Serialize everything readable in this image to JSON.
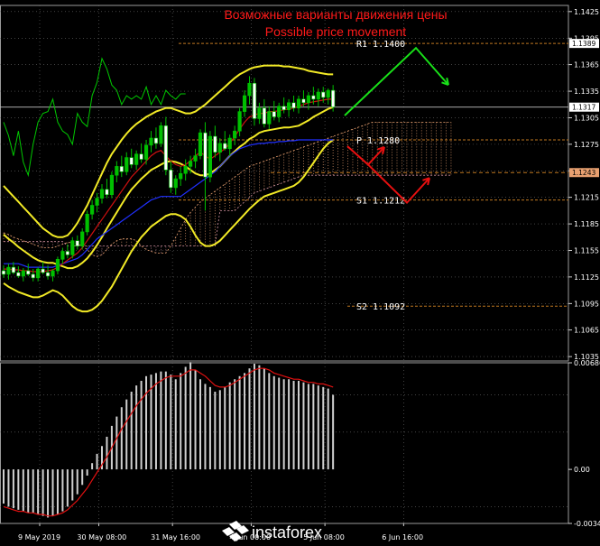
{
  "title_ru": "Возможные варианты движения цены",
  "title_en": "Possible price movement",
  "watermark": "instaforex",
  "colors": {
    "background": "#000000",
    "grid": "#6b6b6b",
    "candle_up": "#00c000",
    "candle_body_down": "#ffffff",
    "bollinger": "#f2ea26",
    "tenkan": "#d01010",
    "kijun": "#2030ff",
    "chikou": "#00c800",
    "cloud_orange": "#e8a070",
    "cloud_pink": "#d090a0",
    "up_arrow": "#19e019",
    "down_arrow": "#e81010",
    "macd_hist": "#d0d0d0",
    "macd_signal": "#e01010",
    "level_line": "#c07820",
    "title": "#ff1a1a"
  },
  "chart_data": [
    {
      "type": "candlestick",
      "title": "Возможные варианты движения цены / Possible price movement",
      "xlabel": "",
      "ylabel": "",
      "ylim": [
        1.103,
        1.1432
      ],
      "y_ticks": [
        "1.1425",
        "1.1395",
        "1.1365",
        "1.1335",
        "1.1305",
        "1.1275",
        "1.1245",
        "1.1215",
        "1.1185",
        "1.1155",
        "1.1125",
        "1.1095",
        "1.1065",
        "1.1035"
      ],
      "x_ticks": [
        "9 May 2019",
        "30 May 08:00",
        "31 May 16:00",
        "4 Jun 00:00",
        "5 Jun 08:00",
        "6 Jun 16:00"
      ],
      "x_tick_bar": [
        0,
        12,
        27,
        43,
        58,
        74
      ],
      "price_tags": [
        {
          "label": "1.1389",
          "value": 1.1389,
          "style": "white"
        },
        {
          "label": "1.1317",
          "value": 1.1317,
          "style": "white"
        },
        {
          "label": "1.1243",
          "value": 1.1243,
          "style": "orange"
        }
      ],
      "levels": [
        {
          "name": "R1",
          "label": "R1 1.1400",
          "value": 1.1389
        },
        {
          "name": "P",
          "label": "P 1.1280",
          "value": 1.128
        },
        {
          "name": "S1",
          "label": "S1 1.1212",
          "value": 1.1212
        },
        {
          "name": "S2",
          "label": "S2 1.1092",
          "value": 1.1092
        }
      ],
      "close_line": 1.1317,
      "candles": [
        [
          1.1132,
          1.1138,
          1.1124,
          1.1128
        ],
        [
          1.1128,
          1.114,
          1.1122,
          1.1136
        ],
        [
          1.1136,
          1.1142,
          1.1128,
          1.113
        ],
        [
          1.113,
          1.1137,
          1.1124,
          1.1126
        ],
        [
          1.1126,
          1.1135,
          1.112,
          1.1132
        ],
        [
          1.1132,
          1.114,
          1.1126,
          1.1128
        ],
        [
          1.1128,
          1.1134,
          1.112,
          1.1124
        ],
        [
          1.1124,
          1.1136,
          1.112,
          1.1134
        ],
        [
          1.1134,
          1.1142,
          1.1128,
          1.113
        ],
        [
          1.113,
          1.1138,
          1.1122,
          1.1126
        ],
        [
          1.1126,
          1.1134,
          1.112,
          1.1132
        ],
        [
          1.1132,
          1.1148,
          1.1128,
          1.1145
        ],
        [
          1.1145,
          1.1158,
          1.114,
          1.1154
        ],
        [
          1.1154,
          1.1162,
          1.1146,
          1.115
        ],
        [
          1.115,
          1.117,
          1.1146,
          1.1166
        ],
        [
          1.1166,
          1.1172,
          1.1156,
          1.116
        ],
        [
          1.116,
          1.118,
          1.1156,
          1.1176
        ],
        [
          1.1176,
          1.12,
          1.1172,
          1.1196
        ],
        [
          1.1196,
          1.1212,
          1.119,
          1.1206
        ],
        [
          1.1206,
          1.122,
          1.1198,
          1.1214
        ],
        [
          1.1214,
          1.123,
          1.1208,
          1.1224
        ],
        [
          1.1224,
          1.1236,
          1.1214,
          1.1218
        ],
        [
          1.1218,
          1.1244,
          1.1214,
          1.124
        ],
        [
          1.124,
          1.1256,
          1.1232,
          1.125
        ],
        [
          1.125,
          1.1262,
          1.1238,
          1.1244
        ],
        [
          1.1244,
          1.1266,
          1.124,
          1.126
        ],
        [
          1.126,
          1.127,
          1.1248,
          1.1252
        ],
        [
          1.1252,
          1.1268,
          1.1246,
          1.1264
        ],
        [
          1.1264,
          1.1276,
          1.1254,
          1.1258
        ],
        [
          1.1258,
          1.128,
          1.1252,
          1.1274
        ],
        [
          1.1274,
          1.129,
          1.1266,
          1.1282
        ],
        [
          1.1282,
          1.1294,
          1.127,
          1.1276
        ],
        [
          1.1276,
          1.13,
          1.1272,
          1.1296
        ],
        [
          1.1296,
          1.1306,
          1.124,
          1.1246
        ],
        [
          1.1246,
          1.1256,
          1.122,
          1.1226
        ],
        [
          1.1226,
          1.124,
          1.1218,
          1.1236
        ],
        [
          1.1236,
          1.125,
          1.1228,
          1.1242
        ],
        [
          1.1242,
          1.1258,
          1.1234,
          1.125
        ],
        [
          1.125,
          1.1262,
          1.1242,
          1.1256
        ],
        [
          1.1256,
          1.127,
          1.1248,
          1.1262
        ],
        [
          1.1262,
          1.1292,
          1.1258,
          1.1288
        ],
        [
          1.1288,
          1.13,
          1.12,
          1.1238
        ],
        [
          1.1238,
          1.129,
          1.1232,
          1.1284
        ],
        [
          1.1284,
          1.1296,
          1.126,
          1.1266
        ],
        [
          1.1266,
          1.1282,
          1.1256,
          1.1276
        ],
        [
          1.1276,
          1.129,
          1.1268,
          1.127
        ],
        [
          1.127,
          1.1286,
          1.1262,
          1.1282
        ],
        [
          1.1282,
          1.1296,
          1.1274,
          1.129
        ],
        [
          1.129,
          1.1316,
          1.1284,
          1.1312
        ],
        [
          1.1312,
          1.1336,
          1.1306,
          1.133
        ],
        [
          1.133,
          1.1352,
          1.132,
          1.1344
        ],
        [
          1.1344,
          1.135,
          1.1296,
          1.1304
        ],
        [
          1.1304,
          1.1322,
          1.1298,
          1.1316
        ],
        [
          1.1316,
          1.1326,
          1.1294,
          1.1298
        ],
        [
          1.1298,
          1.1318,
          1.1292,
          1.1312
        ],
        [
          1.1312,
          1.1324,
          1.1302,
          1.1306
        ],
        [
          1.1306,
          1.1322,
          1.13,
          1.1318
        ],
        [
          1.1318,
          1.1328,
          1.131,
          1.1314
        ],
        [
          1.1314,
          1.1326,
          1.1306,
          1.1322
        ],
        [
          1.1322,
          1.133,
          1.1312,
          1.1316
        ],
        [
          1.1316,
          1.133,
          1.131,
          1.1326
        ],
        [
          1.1326,
          1.1336,
          1.1318,
          1.1322
        ],
        [
          1.1322,
          1.1334,
          1.1314,
          1.133
        ],
        [
          1.133,
          1.134,
          1.132,
          1.1326
        ],
        [
          1.1326,
          1.1338,
          1.1318,
          1.1334
        ],
        [
          1.1334,
          1.134,
          1.1322,
          1.1328
        ],
        [
          1.1328,
          1.1338,
          1.132,
          1.1336
        ],
        [
          1.1336,
          1.1342,
          1.1312,
          1.1317
        ]
      ],
      "bb_upper": [
        1.1228,
        1.1222,
        1.1216,
        1.121,
        1.1204,
        1.1198,
        1.1192,
        1.1186,
        1.118,
        1.1176,
        1.1172,
        1.117,
        1.117,
        1.1172,
        1.1178,
        1.1186,
        1.1196,
        1.1206,
        1.1218,
        1.123,
        1.1242,
        1.1254,
        1.1264,
        1.1272,
        1.128,
        1.1287,
        1.1293,
        1.1298,
        1.1302,
        1.1306,
        1.1309,
        1.1312,
        1.1314,
        1.1316,
        1.1316,
        1.1314,
        1.1312,
        1.131,
        1.131,
        1.1312,
        1.1316,
        1.132,
        1.1325,
        1.133,
        1.1335,
        1.134,
        1.1345,
        1.135,
        1.1354,
        1.1357,
        1.136,
        1.1362,
        1.1363,
        1.1364,
        1.1364,
        1.1364,
        1.1364,
        1.1363,
        1.1363,
        1.1362,
        1.1361,
        1.136,
        1.1358,
        1.1357,
        1.1356,
        1.1355,
        1.1354,
        1.1354
      ],
      "bb_lower": [
        1.1118,
        1.1114,
        1.1111,
        1.1108,
        1.1106,
        1.1104,
        1.1102,
        1.1102,
        1.1104,
        1.1107,
        1.111,
        1.1108,
        1.1104,
        1.1098,
        1.1092,
        1.1088,
        1.1086,
        1.1086,
        1.1088,
        1.1092,
        1.1098,
        1.1106,
        1.1114,
        1.1124,
        1.1134,
        1.1144,
        1.1154,
        1.1162,
        1.117,
        1.1176,
        1.1182,
        1.1186,
        1.119,
        1.1194,
        1.1196,
        1.1196,
        1.1194,
        1.119,
        1.1182,
        1.1172,
        1.1164,
        1.116,
        1.116,
        1.1162,
        1.1166,
        1.1172,
        1.1178,
        1.1184,
        1.119,
        1.1196,
        1.1202,
        1.1207,
        1.1212,
        1.1216,
        1.1218,
        1.122,
        1.1222,
        1.1224,
        1.1226,
        1.1228,
        1.1232,
        1.1238,
        1.1246,
        1.1254,
        1.1262,
        1.127,
        1.1276,
        1.128
      ],
      "bb_middle": [
        1.1173,
        1.1168,
        1.1164,
        1.1159,
        1.1155,
        1.1151,
        1.1147,
        1.1144,
        1.1142,
        1.1141,
        1.1141,
        1.1139,
        1.1137,
        1.1135,
        1.1135,
        1.1137,
        1.1141,
        1.1146,
        1.1153,
        1.1161,
        1.117,
        1.118,
        1.1189,
        1.1198,
        1.1207,
        1.1216,
        1.1224,
        1.123,
        1.1236,
        1.1241,
        1.1246,
        1.1249,
        1.1252,
        1.1255,
        1.1256,
        1.1255,
        1.1253,
        1.125,
        1.1246,
        1.1242,
        1.124,
        1.124,
        1.1242,
        1.1246,
        1.125,
        1.1256,
        1.1262,
        1.1267,
        1.1272,
        1.1276,
        1.1281,
        1.1284,
        1.1288,
        1.129,
        1.1291,
        1.1292,
        1.1293,
        1.1294,
        1.1294,
        1.1295,
        1.1296,
        1.1299,
        1.1302,
        1.1306,
        1.1309,
        1.1312,
        1.1315,
        1.1317
      ],
      "tenkan": [
        1.1134,
        1.1134,
        1.1133,
        1.1133,
        1.1132,
        1.1132,
        1.1131,
        1.1131,
        1.1131,
        1.1132,
        1.1133,
        1.1136,
        1.114,
        1.1144,
        1.1148,
        1.1152,
        1.1158,
        1.1166,
        1.1174,
        1.1182,
        1.119,
        1.1198,
        1.1206,
        1.1214,
        1.1222,
        1.123,
        1.1238,
        1.1244,
        1.125,
        1.1256,
        1.1262,
        1.1266,
        1.1268,
        1.1262,
        1.1256,
        1.1252,
        1.125,
        1.1252,
        1.1256,
        1.1262,
        1.1266,
        1.1262,
        1.1258,
        1.1262,
        1.1266,
        1.127,
        1.1276,
        1.1284,
        1.1292,
        1.13,
        1.1306,
        1.1308,
        1.131,
        1.131,
        1.1312,
        1.1312,
        1.1313,
        1.1314,
        1.1315,
        1.1316,
        1.1318,
        1.132,
        1.1322,
        1.1323,
        1.1324,
        1.1325,
        1.1326,
        1.1326
      ],
      "kijun": [
        1.114,
        1.114,
        1.114,
        1.114,
        1.1138,
        1.1136,
        1.1136,
        1.1136,
        1.1136,
        1.1136,
        1.1136,
        1.1138,
        1.114,
        1.1142,
        1.1144,
        1.1146,
        1.115,
        1.1156,
        1.1162,
        1.1168,
        1.1172,
        1.1176,
        1.118,
        1.1184,
        1.1188,
        1.1192,
        1.1196,
        1.12,
        1.1204,
        1.1208,
        1.1212,
        1.1214,
        1.1216,
        1.1216,
        1.1216,
        1.1216,
        1.1216,
        1.122,
        1.1224,
        1.1228,
        1.1232,
        1.1236,
        1.124,
        1.1244,
        1.125,
        1.1256,
        1.1262,
        1.1266,
        1.127,
        1.1272,
        1.1274,
        1.1275,
        1.1276,
        1.1276,
        1.1277,
        1.1277,
        1.1278,
        1.1278,
        1.1279,
        1.1279,
        1.128,
        1.128,
        1.128,
        1.128,
        1.128,
        1.128,
        1.128,
        1.128
      ],
      "chikou": [
        1.13,
        1.1285,
        1.1262,
        1.129,
        1.1255,
        1.124,
        1.1275,
        1.13,
        1.131,
        1.1312,
        1.1326,
        1.13,
        1.129,
        1.1286,
        1.1275,
        1.131,
        1.13,
        1.1295,
        1.133,
        1.1345,
        1.1372,
        1.136,
        1.1342,
        1.1336,
        1.132,
        1.133,
        1.1326,
        1.133,
        1.1326,
        1.134,
        1.132,
        1.133,
        1.132,
        1.1336,
        1.133,
        1.1326,
        1.1332,
        1.1332
      ],
      "cloud_a": [
        1.1175,
        1.1173,
        1.117,
        1.1168,
        1.1166,
        1.1164,
        1.1162,
        1.116,
        1.1158,
        1.1158,
        1.1158,
        1.116,
        1.1162,
        1.1164,
        1.1164,
        1.1162,
        1.116,
        1.1156,
        1.115,
        1.1148,
        1.115,
        1.1156,
        1.1162,
        1.1166,
        1.1168,
        1.1168,
        1.1168,
        1.1166,
        1.116,
        1.1156,
        1.1154,
        1.1152,
        1.1152,
        1.1152,
        1.116,
        1.117,
        1.118,
        1.119,
        1.1198,
        1.1204,
        1.121,
        1.1214,
        1.1218,
        1.1222,
        1.1226,
        1.123,
        1.1234,
        1.1238,
        1.1242,
        1.1246,
        1.125,
        1.1252,
        1.1254,
        1.1256,
        1.1258,
        1.126,
        1.1262,
        1.1264,
        1.1266,
        1.1268,
        1.127,
        1.1272,
        1.1274,
        1.1276,
        1.1278,
        1.128,
        1.1282,
        1.1284,
        1.1286,
        1.1288,
        1.129,
        1.1292,
        1.1294,
        1.1296,
        1.1298,
        1.13,
        1.13,
        1.13,
        1.13,
        1.13,
        1.13,
        1.13,
        1.13,
        1.13,
        1.13,
        1.13,
        1.13,
        1.13,
        1.13,
        1.13,
        1.13,
        1.13
      ],
      "cloud_b": [
        1.1165,
        1.1165,
        1.1165,
        1.1165,
        1.1165,
        1.1165,
        1.1165,
        1.1165,
        1.1165,
        1.1165,
        1.1165,
        1.1165,
        1.1165,
        1.116,
        1.116,
        1.116,
        1.116,
        1.116,
        1.116,
        1.116,
        1.116,
        1.116,
        1.116,
        1.116,
        1.116,
        1.116,
        1.116,
        1.116,
        1.116,
        1.116,
        1.116,
        1.116,
        1.116,
        1.116,
        1.116,
        1.116,
        1.116,
        1.116,
        1.116,
        1.116,
        1.116,
        1.116,
        1.116,
        1.116,
        1.12,
        1.12,
        1.12,
        1.12,
        1.1205,
        1.121,
        1.1215,
        1.122,
        1.1222,
        1.1224,
        1.1226,
        1.1228,
        1.123,
        1.1232,
        1.1234,
        1.1236,
        1.1238,
        1.124,
        1.124,
        1.124,
        1.124,
        1.124,
        1.124,
        1.124,
        1.124,
        1.124,
        1.124,
        1.124,
        1.124,
        1.124,
        1.124,
        1.124,
        1.124,
        1.124,
        1.124,
        1.124,
        1.124,
        1.124,
        1.124,
        1.124,
        1.124,
        1.124,
        1.124,
        1.124,
        1.124,
        1.124,
        1.124,
        1.124
      ]
    },
    {
      "type": "bar",
      "title": "",
      "xlabel": "",
      "ylabel": "",
      "ylim": [
        -0.00348,
        0.00686
      ],
      "y_ticks": [
        "0.00686",
        "0.00",
        "-0.00348"
      ],
      "histogram": [
        -0.0022,
        -0.0024,
        -0.0025,
        -0.0026,
        -0.0027,
        -0.0028,
        -0.0028,
        -0.0029,
        -0.003,
        -0.0031,
        -0.003,
        -0.0029,
        -0.0027,
        -0.0024,
        -0.002,
        -0.0016,
        -0.001,
        -0.0004,
        0.0004,
        0.001,
        0.0015,
        0.0021,
        0.0028,
        0.0034,
        0.004,
        0.0045,
        0.005,
        0.0054,
        0.0057,
        0.006,
        0.0061,
        0.0062,
        0.0063,
        0.0063,
        0.0061,
        0.0058,
        0.0062,
        0.0066,
        0.0069,
        0.0064,
        0.0058,
        0.0055,
        0.0053,
        0.005,
        0.0051,
        0.0053,
        0.0056,
        0.0058,
        0.006,
        0.0062,
        0.0065,
        0.0068,
        0.0067,
        0.0065,
        0.0062,
        0.006,
        0.0059,
        0.0058,
        0.0058,
        0.0057,
        0.0057,
        0.0056,
        0.0055,
        0.0055,
        0.0054,
        0.0053,
        0.0052,
        0.0048
      ],
      "signal": [
        -0.0024,
        -0.0025,
        -0.0026,
        -0.0027,
        -0.0027,
        -0.0028,
        -0.0028,
        -0.0029,
        -0.0029,
        -0.003,
        -0.003,
        -0.0029,
        -0.0028,
        -0.0026,
        -0.0023,
        -0.002,
        -0.0016,
        -0.0012,
        -0.0007,
        -0.0002,
        0.0003,
        0.0008,
        0.0014,
        0.002,
        0.0026,
        0.0031,
        0.0036,
        0.0041,
        0.0045,
        0.0049,
        0.0052,
        0.0055,
        0.0057,
        0.0059,
        0.006,
        0.006,
        0.006,
        0.0062,
        0.0064,
        0.0064,
        0.0062,
        0.006,
        0.0057,
        0.0054,
        0.0053,
        0.0053,
        0.0054,
        0.0056,
        0.0058,
        0.006,
        0.0062,
        0.0064,
        0.0065,
        0.0065,
        0.0064,
        0.0062,
        0.0061,
        0.006,
        0.0059,
        0.0058,
        0.0058,
        0.0057,
        0.0056,
        0.0056,
        0.0055,
        0.0055,
        0.0054,
        0.0053
      ]
    }
  ]
}
